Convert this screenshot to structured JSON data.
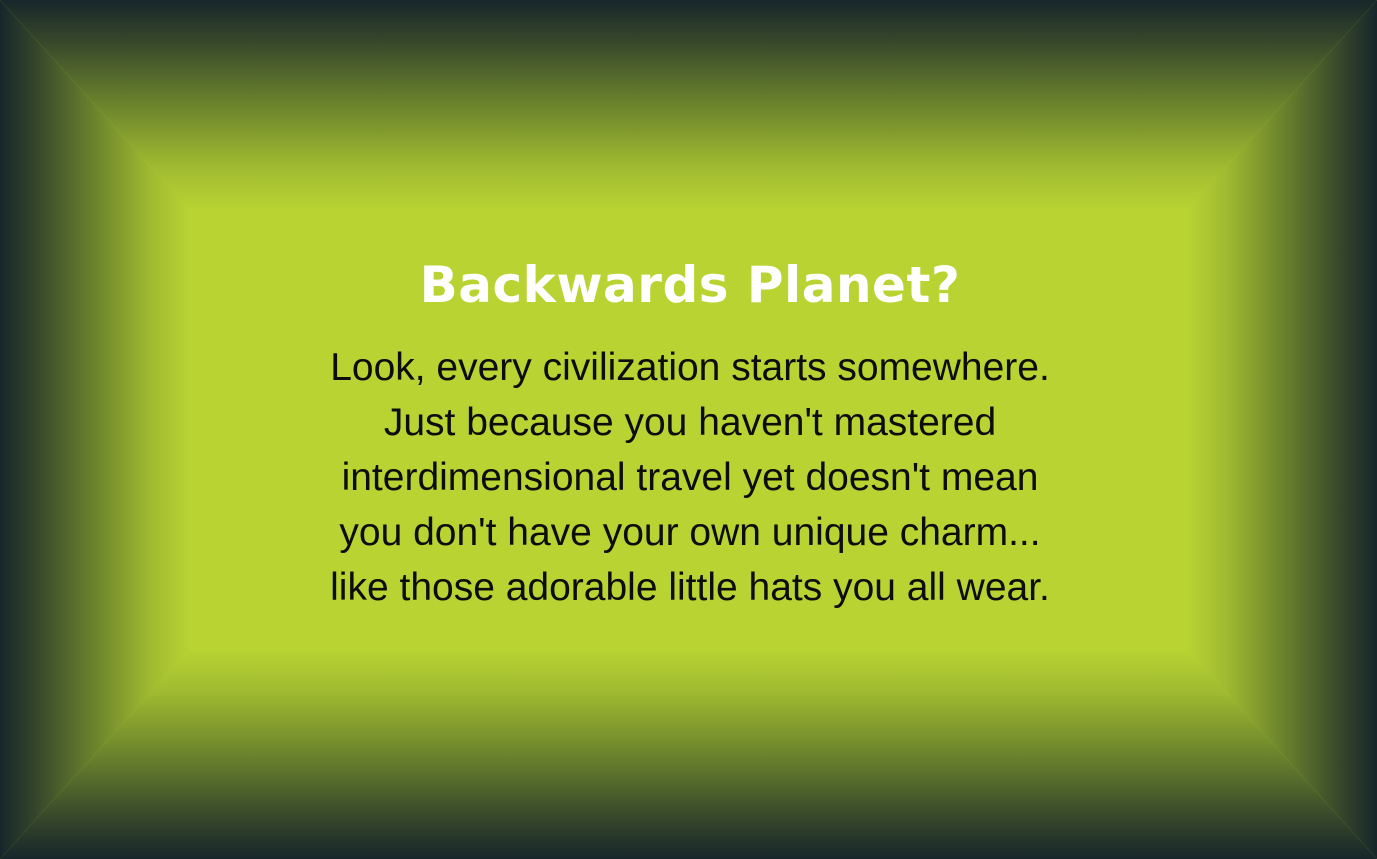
{
  "card": {
    "title": "Backwards Planet?",
    "body_lines": [
      "Look, every civilization starts somewhere.",
      "Just because you haven't mastered",
      "interdimensional travel yet doesn't mean",
      "you don't have your own unique charm...",
      "like those adorable little hats you all wear."
    ]
  },
  "colors": {
    "panel": "#b8d332",
    "frame_dark": "#17262a",
    "title": "#ffffff",
    "body": "#0d0d0d"
  }
}
